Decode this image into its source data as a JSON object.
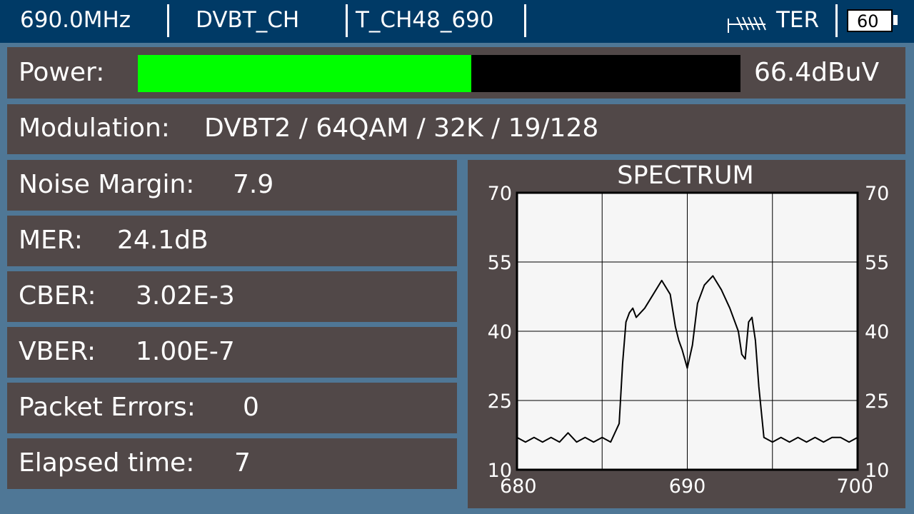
{
  "topbar": {
    "frequency": "690.0MHz",
    "channel_table": "DVBT_CH",
    "channel_name": "T_CH48_690",
    "band": "TER",
    "battery": "60",
    "antenna_icon": "antenna-icon"
  },
  "power": {
    "label": "Power:",
    "value": "66.4dBuV",
    "level_fraction": 0.553,
    "fill_color": "#00ff00"
  },
  "modulation": {
    "label": "Modulation:",
    "value": "DVBT2 / 64QAM / 32K / 19/128"
  },
  "measurements": [
    {
      "label": "Noise Margin:",
      "value": "7.9"
    },
    {
      "label": "MER:",
      "value": "24.1dB"
    },
    {
      "label": "CBER:",
      "value": "3.02E-3"
    },
    {
      "label": "VBER:",
      "value": "1.00E-7"
    },
    {
      "label": "Packet Errors:",
      "value": "0"
    },
    {
      "label": "Elapsed time:",
      "value": "7"
    }
  ],
  "chart_data": {
    "type": "line",
    "title": "SPECTRUM",
    "xlabel": "",
    "ylabel": "",
    "xlim": [
      680,
      700
    ],
    "ylim": [
      10,
      70
    ],
    "x_ticks": [
      "680",
      "690",
      "700"
    ],
    "y_ticks": [
      "70",
      "55",
      "40",
      "25",
      "10"
    ],
    "grid": true,
    "series": [
      {
        "x": [
          680,
          680.5,
          681,
          681.5,
          682,
          682.5,
          683,
          683.5,
          684,
          684.5,
          685,
          685.5,
          686,
          686.2,
          686.4,
          686.6,
          686.8,
          687,
          687.5,
          688,
          688.5,
          689,
          689.3,
          689.5,
          689.7,
          690,
          690.3,
          690.6,
          691,
          691.5,
          692,
          692.5,
          693,
          693.2,
          693.4,
          693.6,
          693.8,
          694,
          694.2,
          694.5,
          695,
          695.5,
          696,
          696.5,
          697,
          697.5,
          698,
          698.5,
          699,
          699.5,
          700
        ],
        "y": [
          17,
          16,
          17,
          16,
          17,
          16,
          18,
          16,
          17,
          16,
          17,
          16,
          20,
          33,
          42,
          44,
          45,
          43,
          45,
          48,
          51,
          48,
          41,
          38,
          36,
          32,
          37,
          46,
          50,
          52,
          49,
          45,
          40,
          35,
          34,
          42,
          43,
          38,
          28,
          17,
          16,
          17,
          16,
          17,
          16,
          17,
          16,
          17,
          17,
          16,
          17
        ]
      }
    ]
  }
}
